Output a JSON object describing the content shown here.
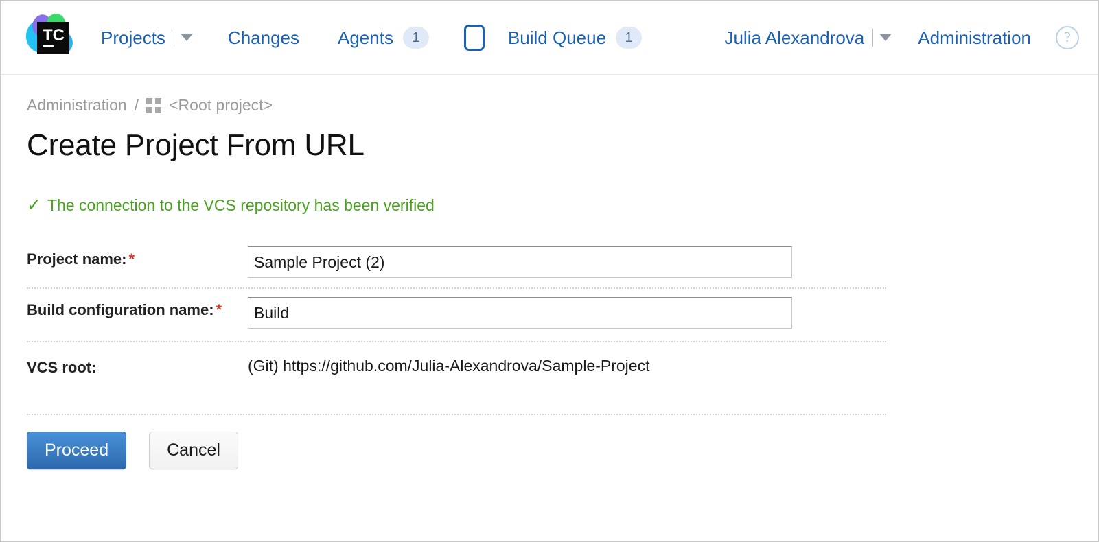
{
  "header": {
    "logo_alt": "TeamCity",
    "logo_text": "TC",
    "nav": {
      "projects": "Projects",
      "changes": "Changes",
      "agents": "Agents",
      "agents_count": "1",
      "build_queue": "Build Queue",
      "build_queue_count": "1",
      "user": "Julia Alexandrova",
      "administration": "Administration",
      "help": "?"
    }
  },
  "breadcrumb": {
    "root": "Administration",
    "separator": "/",
    "current": "<Root project>"
  },
  "page": {
    "title": "Create Project From URL",
    "success_check": "✓",
    "success_message": "The connection to the VCS repository has been verified"
  },
  "form": {
    "rows": [
      {
        "label": "Project name:",
        "required": "*",
        "value": "Sample Project (2)",
        "placeholder": ""
      },
      {
        "label": "Build configuration name:",
        "required": "*",
        "value": "Build",
        "placeholder": ""
      },
      {
        "label": "VCS root:",
        "required": "",
        "value": "(Git) https://github.com/Julia-Alexandrova/Sample-Project"
      }
    ]
  },
  "buttons": {
    "proceed": "Proceed",
    "cancel": "Cancel"
  },
  "colors": {
    "link": "#1b61b3",
    "success": "#4aa320",
    "required": "#d4342c",
    "badge_bg": "#dfe9f7",
    "primary_button": "#3b7fc4"
  }
}
